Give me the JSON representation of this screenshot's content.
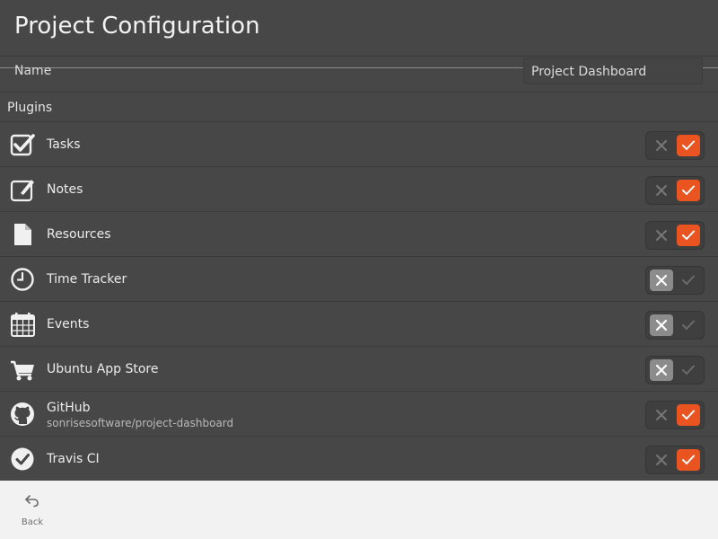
{
  "header": {
    "title": "Project Configuration"
  },
  "name_row": {
    "label": "Name",
    "value": "Project Dashboard"
  },
  "plugins_section": {
    "label": "Plugins"
  },
  "plugins": [
    {
      "name": "Tasks",
      "icon": "checkbox-icon",
      "enabled": true
    },
    {
      "name": "Notes",
      "icon": "edit-note-icon",
      "enabled": true
    },
    {
      "name": "Resources",
      "icon": "document-icon",
      "enabled": true
    },
    {
      "name": "Time Tracker",
      "icon": "clock-icon",
      "enabled": false
    },
    {
      "name": "Events",
      "icon": "calendar-icon",
      "enabled": false
    },
    {
      "name": "Ubuntu App Store",
      "icon": "shopping-cart-icon",
      "enabled": false
    },
    {
      "name": "GitHub",
      "subtitle": "sonrisesoftware/project-dashboard",
      "icon": "github-icon",
      "enabled": true
    },
    {
      "name": "Travis CI",
      "icon": "checkmark-circle-icon",
      "enabled": true
    }
  ],
  "footer": {
    "back_label": "Back",
    "back_icon": "back-arrow-icon"
  },
  "colors": {
    "accent": "#e95420",
    "background": "#474747",
    "footer": "#f2f2f2",
    "toggle_off_knob": "#8c8c8c"
  }
}
